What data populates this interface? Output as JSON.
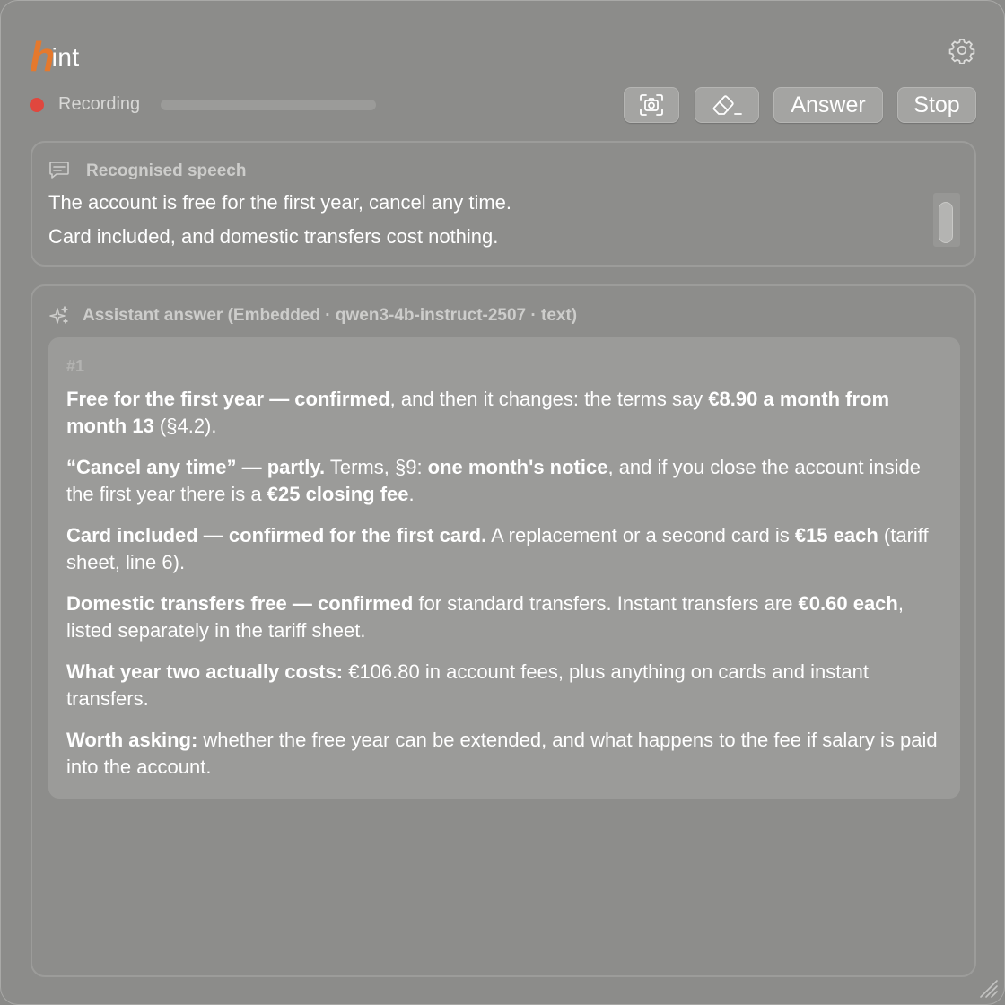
{
  "app": {
    "logo_initial": "h",
    "logo_rest": "int"
  },
  "recording": {
    "label": "Recording",
    "status_color": "#e0473e"
  },
  "toolbar": {
    "screenshot_icon": "camera-viewfinder-icon",
    "clear_icon": "eraser-icon",
    "answer_label": "Answer",
    "stop_label": "Stop"
  },
  "speech": {
    "title": "Recognised speech",
    "icon": "speech-bubble-icon",
    "lines": [
      "The account is free for the first year, cancel any time.",
      "Card included, and domestic transfers cost nothing."
    ]
  },
  "answer": {
    "title": "Assistant answer (Embedded · qwen3-4b-instruct-2507 · text)",
    "icon": "sparkles-icon",
    "number": "#1",
    "paragraphs": [
      [
        {
          "b": true,
          "t": "Free for the first year — confirmed"
        },
        {
          "b": false,
          "t": ", and then it changes: the terms say "
        },
        {
          "b": true,
          "t": "€8.90 a month from month 13"
        },
        {
          "b": false,
          "t": " (§4.2)."
        }
      ],
      [
        {
          "b": true,
          "t": "“Cancel any time” — partly."
        },
        {
          "b": false,
          "t": " Terms, §9: "
        },
        {
          "b": true,
          "t": "one month's notice"
        },
        {
          "b": false,
          "t": ", and if you close the account inside the first year there is a "
        },
        {
          "b": true,
          "t": "€25 closing fee"
        },
        {
          "b": false,
          "t": "."
        }
      ],
      [
        {
          "b": true,
          "t": "Card included — confirmed for the first card."
        },
        {
          "b": false,
          "t": " A replacement or a second card is "
        },
        {
          "b": true,
          "t": "€15 each"
        },
        {
          "b": false,
          "t": " (tariff sheet, line 6)."
        }
      ],
      [
        {
          "b": true,
          "t": "Domestic transfers free — confirmed"
        },
        {
          "b": false,
          "t": " for standard transfers. Instant transfers are "
        },
        {
          "b": true,
          "t": "€0.60 each"
        },
        {
          "b": false,
          "t": ", listed separately in the tariff sheet."
        }
      ],
      [
        {
          "b": true,
          "t": "What year two actually costs:"
        },
        {
          "b": false,
          "t": " €106.80 in account fees, plus anything on cards and instant transfers."
        }
      ],
      [
        {
          "b": true,
          "t": "Worth asking:"
        },
        {
          "b": false,
          "t": " whether the free year can be extended, and what happens to the fee if salary is paid into the account."
        }
      ]
    ]
  },
  "colors": {
    "accent": "#e5792d",
    "background": "#8c8c8a"
  }
}
